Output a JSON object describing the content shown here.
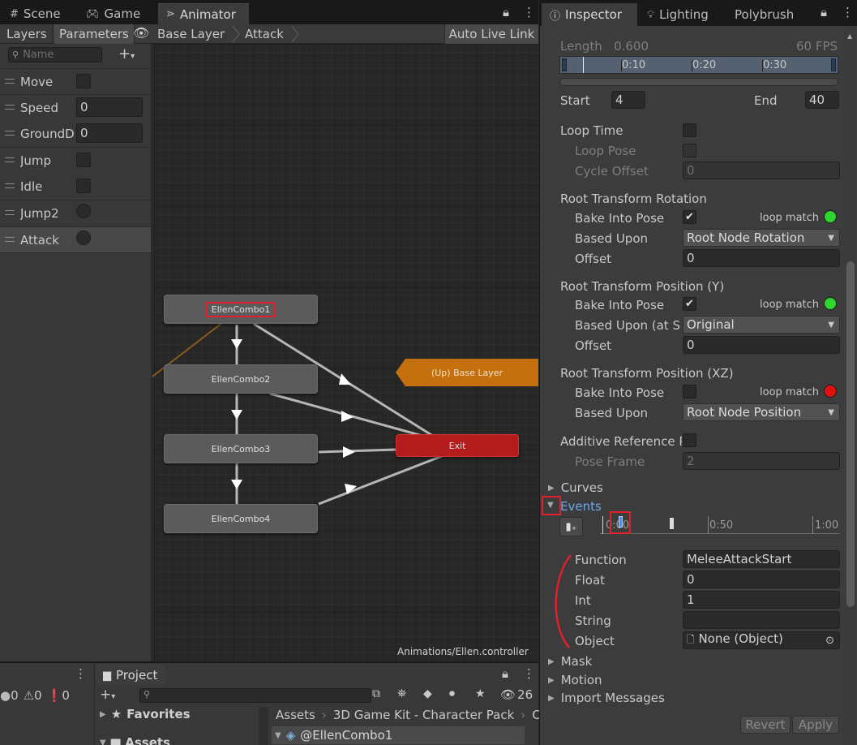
{
  "animator": {
    "tabs": [
      "Scene",
      "Game",
      "Animator"
    ],
    "subtabs": [
      "Layers",
      "Parameters"
    ],
    "breadcrumbs": [
      "Base Layer",
      "Attack"
    ],
    "auto_live_link": "Auto Live Link",
    "search_placeholder": "Name",
    "parameters": [
      {
        "name": "Move",
        "type": "bool",
        "value": ""
      },
      {
        "name": "Speed",
        "type": "float",
        "value": "0"
      },
      {
        "name": "GroundDi",
        "type": "float",
        "value": "0"
      },
      {
        "name": "Jump",
        "type": "bool",
        "value": ""
      },
      {
        "name": "Idle",
        "type": "bool",
        "value": ""
      },
      {
        "name": "Jump2",
        "type": "trigger",
        "value": ""
      },
      {
        "name": "Attack",
        "type": "trigger",
        "value": ""
      }
    ],
    "states": [
      "EllenCombo1",
      "EllenCombo2",
      "EllenCombo3",
      "EllenCombo4"
    ],
    "exit_label": "Exit",
    "up_label": "(Up) Base Layer",
    "path": "Animations/Ellen.controller"
  },
  "console": {
    "errors": "0",
    "warnings": "0",
    "messages": "0"
  },
  "project": {
    "tab": "Project",
    "hidden_count": "26",
    "favorites": "Favorites",
    "assets": "Assets",
    "breadcrumb": [
      "Assets",
      "3D Game Kit - Character Pack",
      "C"
    ],
    "file": "@EllenCombo1"
  },
  "inspector": {
    "tabs": [
      "Inspector",
      "Lighting",
      "Polybrush"
    ],
    "length_label": "Length",
    "length_value": "0.600",
    "fps": "60 FPS",
    "timeline_ticks": [
      "0:10",
      "0:20",
      "0:30"
    ],
    "start_label": "Start",
    "start_value": "4",
    "end_label": "End",
    "end_value": "40",
    "loop_time": "Loop Time",
    "loop_pose": "Loop Pose",
    "cycle_offset": "Cycle Offset",
    "cycle_offset_value": "0",
    "rot_header": "Root Transform Rotation",
    "bake_into_pose": "Bake Into Pose",
    "loop_match": "loop match",
    "based_upon": "Based Upon",
    "rot_based_value": "Root Node Rotation",
    "offset": "Offset",
    "rot_offset_value": "0",
    "posy_header": "Root Transform Position (Y)",
    "posy_based_label": "Based Upon (at St",
    "posy_based_value": "Original",
    "posy_offset_value": "0",
    "posxz_header": "Root Transform Position (XZ)",
    "posxz_based_value": "Root Node Position",
    "additive": "Additive Reference P",
    "pose_frame": "Pose Frame",
    "pose_frame_value": "2",
    "curves": "Curves",
    "events": "Events",
    "event_ticks": [
      "0:00",
      "0:50",
      "1:00"
    ],
    "event_fields": [
      {
        "label": "Function",
        "value": "MeleeAttackStart"
      },
      {
        "label": "Float",
        "value": "0"
      },
      {
        "label": "Int",
        "value": "1"
      },
      {
        "label": "String",
        "value": ""
      },
      {
        "label": "Object",
        "value": "None (Object)"
      }
    ],
    "mask": "Mask",
    "motion": "Motion",
    "import_messages": "Import Messages",
    "revert": "Revert",
    "apply": "Apply",
    "colors": {
      "loop_match_good": "#2fd62f",
      "loop_match_bad": "#e01010",
      "highlight": "#e0202a"
    }
  }
}
